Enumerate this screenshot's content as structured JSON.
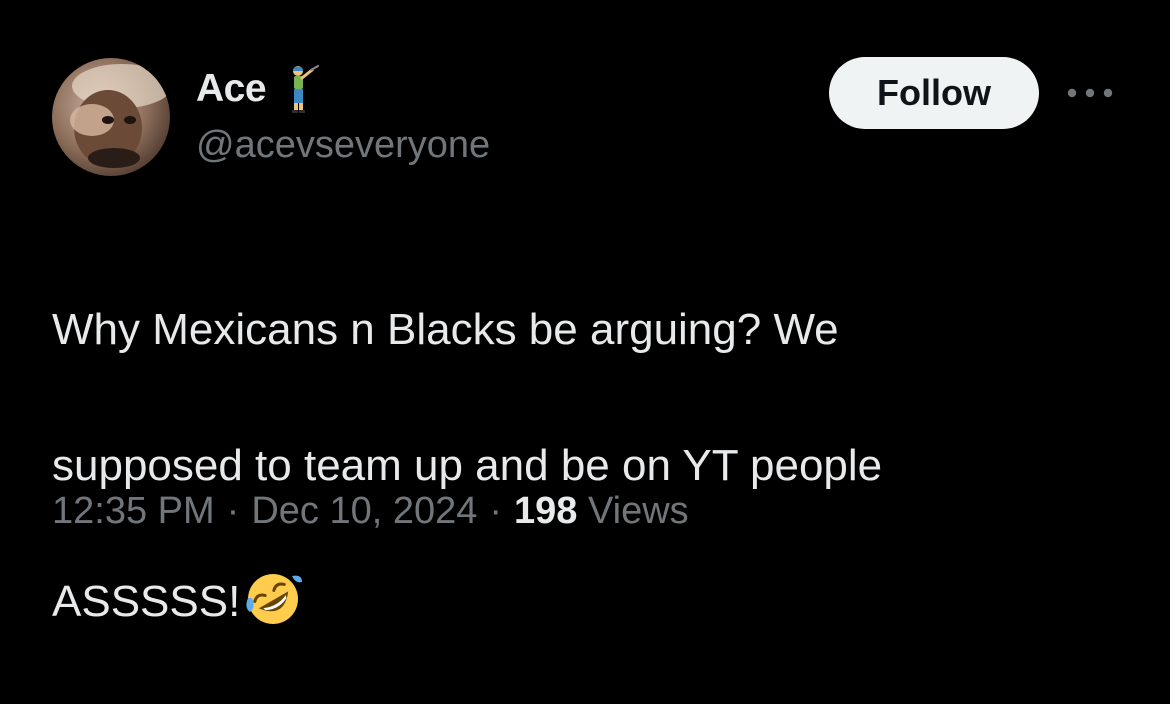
{
  "author": {
    "display_name": "Ace",
    "handle": "@acevseveryone",
    "name_emoji": "golfer-icon"
  },
  "actions": {
    "follow_label": "Follow",
    "more_icon": "more-options-icon"
  },
  "tweet": {
    "text_lines": [
      "Why Mexicans n Blacks be arguing? We",
      "supposed to team up and be on YT people",
      "ASSSSS!"
    ],
    "trailing_emoji": "rolling-on-floor-laughing-icon"
  },
  "meta": {
    "time": "12:35 PM",
    "separator": "·",
    "date": "Dec 10, 2024",
    "views_count": "198",
    "views_label": "Views"
  },
  "colors": {
    "background": "#000000",
    "primary_text": "#e7e9ea",
    "secondary_text": "#71767b",
    "follow_bg": "#eff3f4",
    "follow_text": "#0f1419"
  }
}
